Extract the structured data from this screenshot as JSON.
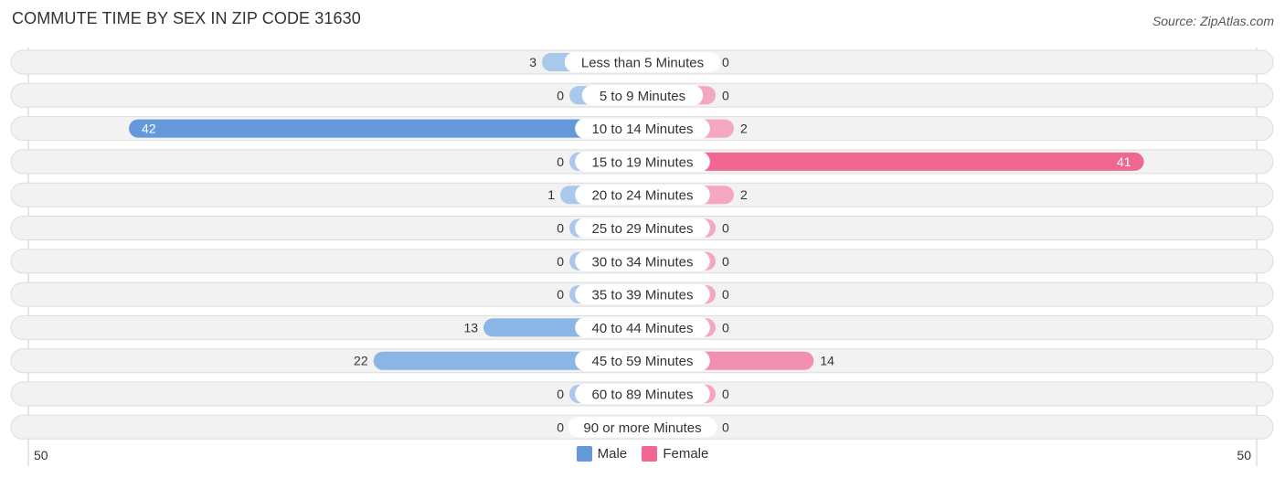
{
  "title": "COMMUTE TIME BY SEX IN ZIP CODE 31630",
  "source": "Source: ZipAtlas.com",
  "colors": {
    "male": "#6399db",
    "male_light": "#a9c8ec",
    "female": "#f06892",
    "female_light": "#f5a7bf",
    "row_bg": "#f2f2f2",
    "row_border": "#dddddd"
  },
  "chart_data": {
    "type": "bar",
    "orientation": "horizontal-diverging",
    "title": "COMMUTE TIME BY SEX IN ZIP CODE 31630",
    "categories": [
      "Less than 5 Minutes",
      "5 to 9 Minutes",
      "10 to 14 Minutes",
      "15 to 19 Minutes",
      "20 to 24 Minutes",
      "25 to 29 Minutes",
      "30 to 34 Minutes",
      "35 to 39 Minutes",
      "40 to 44 Minutes",
      "45 to 59 Minutes",
      "60 to 89 Minutes",
      "90 or more Minutes"
    ],
    "series": [
      {
        "name": "Male",
        "values": [
          3,
          0,
          42,
          0,
          1,
          0,
          0,
          0,
          13,
          22,
          0,
          0
        ]
      },
      {
        "name": "Female",
        "values": [
          0,
          0,
          2,
          41,
          2,
          0,
          0,
          0,
          0,
          14,
          0,
          0
        ]
      }
    ],
    "xlim": [
      -50,
      50
    ],
    "axis_tick_labels": {
      "left": "50",
      "right": "50"
    },
    "legend": {
      "placement": "bottom-center",
      "entries": [
        "Male",
        "Female"
      ]
    }
  }
}
